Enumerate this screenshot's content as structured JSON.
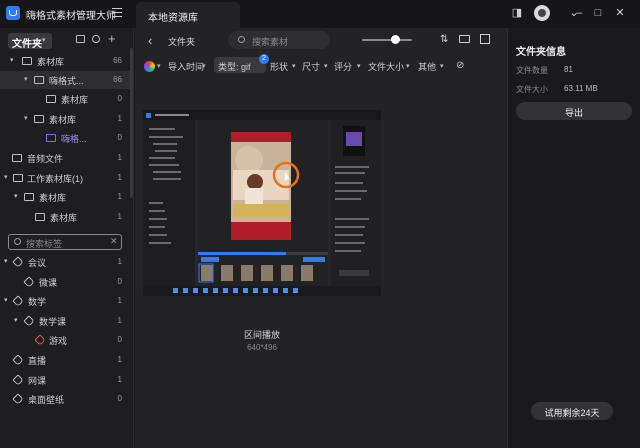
{
  "app": {
    "title": "嗨格式素材管理大师",
    "tab": "本地资源库"
  },
  "sidebar": {
    "header": "文件夹",
    "tree": [
      {
        "label": "素材库",
        "count": "66"
      },
      {
        "label": "嗨格式...",
        "count": "66"
      },
      {
        "label": "素材库",
        "count": "0"
      },
      {
        "label": "素材库",
        "count": "1"
      },
      {
        "label": "嗨格...",
        "count": "0"
      },
      {
        "label": "音频文件",
        "count": "1"
      },
      {
        "label": "工作素材库(1)",
        "count": "1"
      },
      {
        "label": "素材库",
        "count": "1"
      },
      {
        "label": "素材库",
        "count": "1"
      }
    ],
    "tag_search_placeholder": "搜索标签",
    "tags": [
      {
        "label": "会议",
        "count": "1"
      },
      {
        "label": "微课",
        "count": "0"
      },
      {
        "label": "数学",
        "count": "1"
      },
      {
        "label": "数学课",
        "count": "1"
      },
      {
        "label": "游戏",
        "count": "0"
      },
      {
        "label": "直播",
        "count": "1"
      },
      {
        "label": "网课",
        "count": "1"
      },
      {
        "label": "桌面壁纸",
        "count": "0"
      }
    ]
  },
  "toolbar": {
    "back": "‹",
    "breadcrumb": "文件夹",
    "search_placeholder": "搜索素材"
  },
  "filters": {
    "items": [
      "导入时间",
      "类型: gif",
      "形状",
      "尺寸",
      "评分",
      "文件大小",
      "其他"
    ],
    "badge": "2"
  },
  "asset": {
    "name": "区间播放",
    "dims": "640*496"
  },
  "info": {
    "title": "文件夹信息",
    "count_label": "文件数量",
    "count_value": "81",
    "size_label": "文件大小",
    "size_value": "63.11 MB",
    "export": "导出",
    "trial": "试用剩余24天"
  },
  "colors": {
    "accent": "#2f7df6",
    "orange": "#e8701a"
  },
  "icons": [
    "menu-icon",
    "back-icon",
    "search-icon",
    "slider-icon",
    "sort-icon",
    "view-icon",
    "grid-icon",
    "user-icon",
    "minimize-icon",
    "maximize-icon",
    "close-icon",
    "folder-icon",
    "tag-icon",
    "color-icon",
    "clear-filter-icon"
  ]
}
